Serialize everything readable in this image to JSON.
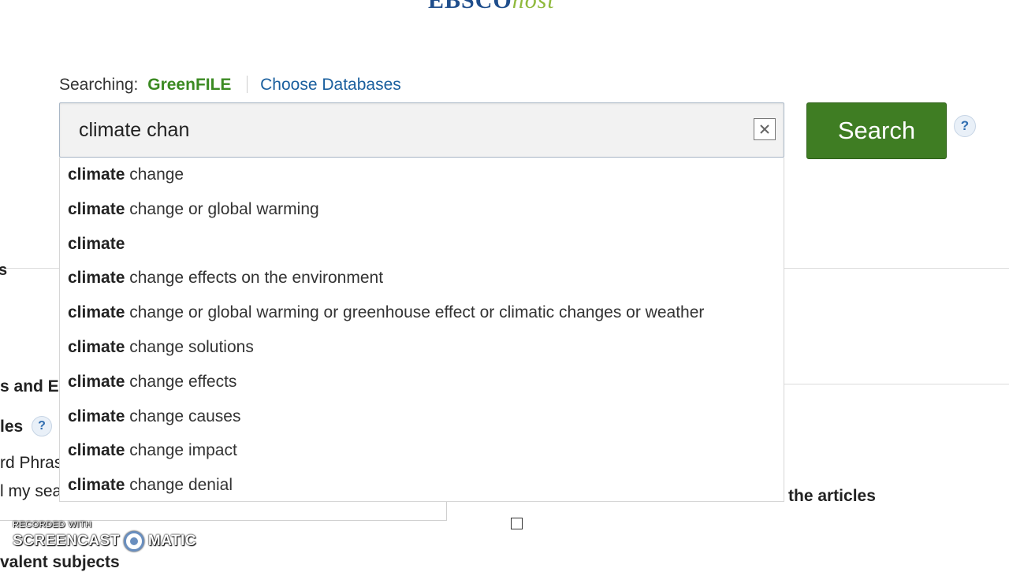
{
  "logo": {
    "primary": "EBSCO",
    "secondary": "host"
  },
  "searching": {
    "label": "Searching:",
    "database": "GreenFILE",
    "choose_link": "Choose Databases"
  },
  "search": {
    "value": "climate chan",
    "button_label": "Search",
    "help": "?"
  },
  "suggestions": [
    {
      "bold": "climate",
      "rest": " change"
    },
    {
      "bold": "climate",
      "rest": " change or global warming"
    },
    {
      "bold": "climate",
      "rest": ""
    },
    {
      "bold": "climate",
      "rest": " change effects on the environment"
    },
    {
      "bold": "climate",
      "rest": " change or global warming or greenhouse effect or climatic changes or weather"
    },
    {
      "bold": "climate",
      "rest": " change solutions"
    },
    {
      "bold": "climate",
      "rest": " change effects"
    },
    {
      "bold": "climate",
      "rest": " change causes"
    },
    {
      "bold": "climate",
      "rest": " change impact"
    },
    {
      "bold": "climate",
      "rest": " change denial"
    }
  ],
  "background": {
    "frag_s": "s",
    "frag_s_and": "s and E",
    "frag_les": "les",
    "help": "?",
    "frag_phrase": "rd Phras",
    "frag_sea": "l my sea",
    "frag_subjects": "valent subjects",
    "frag_articles": "the articles"
  },
  "watermark": {
    "small": "RECORDED WITH",
    "left": "SCREENCAST",
    "right": "MATIC"
  },
  "colors": {
    "accent_green": "#3f7d23",
    "link_blue": "#1a5f9e",
    "database_green": "#3b8a22"
  }
}
